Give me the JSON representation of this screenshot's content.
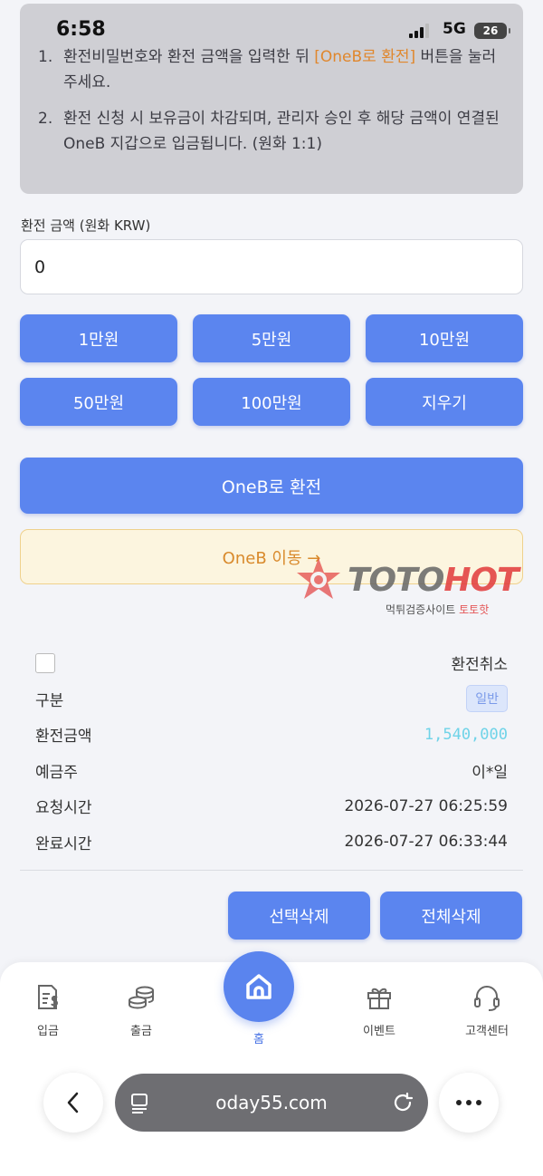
{
  "status": {
    "time": "6:58",
    "network": "5G",
    "battery": "26"
  },
  "notice": {
    "items": [
      {
        "num": "1.",
        "before": "환전비밀번호와 환전 금액을 입력한 뒤 ",
        "highlight": "[OneB로 환전]",
        "after": " 버튼을 눌러주세요."
      },
      {
        "num": "2.",
        "text": "환전 신청 시 보유금이 차감되며, 관리자 승인 후 해당 금액이 연결된 OneB 지갑으로 입금됩니다. (원화 1:1)"
      }
    ]
  },
  "form": {
    "amount_label": "환전 금액 (원화 KRW)",
    "amount_value": "0"
  },
  "quick_amounts": [
    "1만원",
    "5만원",
    "10만원",
    "50만원",
    "100만원",
    "지우기"
  ],
  "actions": {
    "exchange": "OneB로 환전",
    "move": "OneB 이동 →"
  },
  "watermark": {
    "toto": "TOTO",
    "hot": "HOT",
    "sub_prefix": "먹튀검증사이트 ",
    "sub_brand": "토토핫"
  },
  "record": {
    "cancel_label": "환전취소",
    "type_label": "구분",
    "type_value": "일반",
    "amount_label": "환전금액",
    "amount_value": "1,540,000",
    "holder_label": "예금주",
    "holder_value": "이*일",
    "request_label": "요청시간",
    "request_value": "2026-07-27 06:25:59",
    "complete_label": "완료시간",
    "complete_value": "2026-07-27 06:33:44"
  },
  "delete": {
    "selected": "선택삭제",
    "all": "전체삭제"
  },
  "nav": {
    "deposit": "입금",
    "withdraw": "출금",
    "home": "홈",
    "event": "이벤트",
    "support": "고객센터"
  },
  "browser": {
    "url": "oday55.com"
  },
  "colors": {
    "primary": "#5b85ef",
    "accent_orange": "#e0872d",
    "amount_cyan": "#6fd3e8"
  }
}
